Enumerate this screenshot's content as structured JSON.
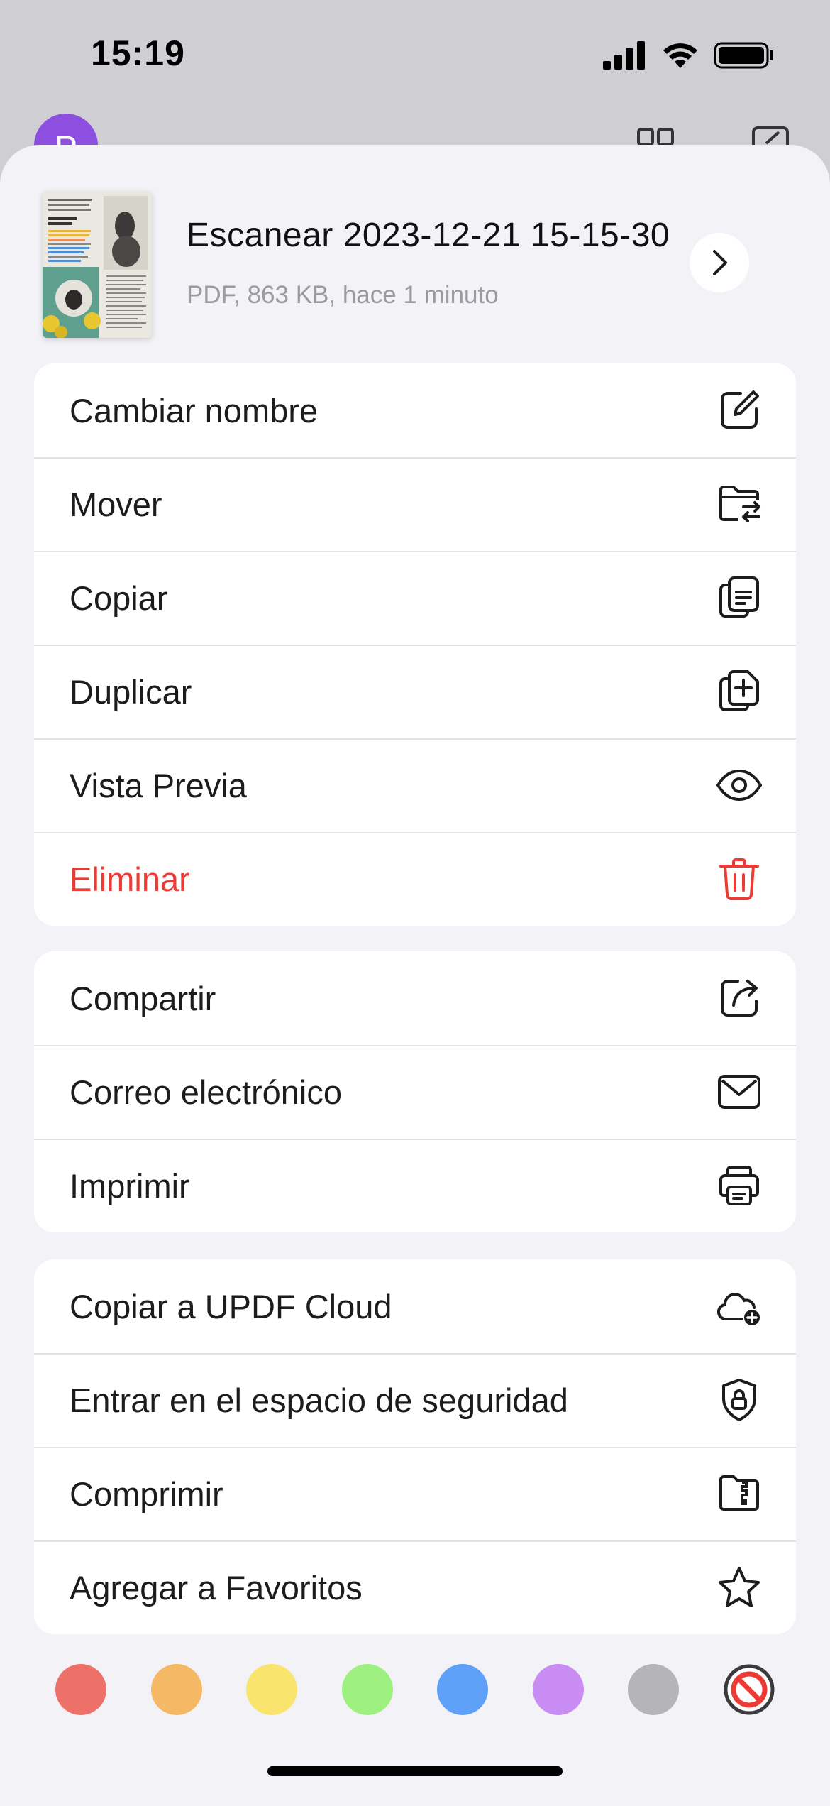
{
  "status_bar": {
    "time": "15:19"
  },
  "background_app": {
    "avatar_letter": "P"
  },
  "file": {
    "title": "Escanear 2023-12-21 15-15-30",
    "meta": "PDF, 863 KB, hace 1 minuto"
  },
  "groups": [
    {
      "items": [
        {
          "label": "Cambiar nombre",
          "icon": "rename-icon"
        },
        {
          "label": "Mover",
          "icon": "move-folder-icon"
        },
        {
          "label": "Copiar",
          "icon": "copy-icon"
        },
        {
          "label": "Duplicar",
          "icon": "duplicate-icon"
        },
        {
          "label": "Vista Previa",
          "icon": "eye-icon"
        },
        {
          "label": "Eliminar",
          "icon": "trash-icon",
          "destructive": true
        }
      ]
    },
    {
      "items": [
        {
          "label": "Compartir",
          "icon": "share-icon"
        },
        {
          "label": "Correo electrónico",
          "icon": "mail-icon"
        },
        {
          "label": "Imprimir",
          "icon": "printer-icon"
        }
      ]
    },
    {
      "items": [
        {
          "label": "Copiar a UPDF Cloud",
          "icon": "cloud-add-icon"
        },
        {
          "label": "Entrar en el espacio de seguridad",
          "icon": "shield-lock-icon"
        },
        {
          "label": "Comprimir",
          "icon": "zip-icon"
        },
        {
          "label": "Agregar a Favoritos",
          "icon": "star-icon"
        }
      ]
    }
  ],
  "colors": {
    "accent_destructive": "#ec3a35",
    "tags": [
      "#ee7169",
      "#f5b865",
      "#f9e46d",
      "#9ef180",
      "#5fa1f9",
      "#c98cf3",
      "#b5b5b9"
    ],
    "no_tag": "none-icon"
  }
}
